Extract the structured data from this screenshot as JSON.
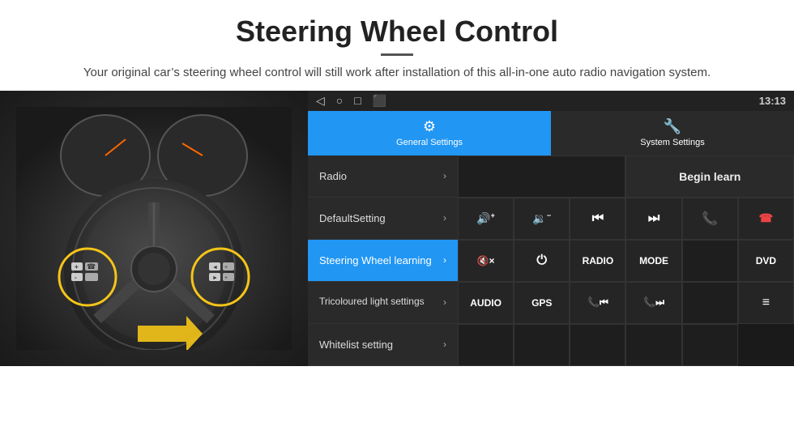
{
  "header": {
    "title": "Steering Wheel Control",
    "divider": true,
    "subtitle": "Your original car’s steering wheel control will still work after installation of this all-in-one auto radio navigation system."
  },
  "statusBar": {
    "icons": [
      "◁",
      "○",
      "□",
      "⬛"
    ],
    "right": "13:13",
    "signalIcons": [
      "wifi",
      "signal"
    ]
  },
  "tabs": [
    {
      "id": "general",
      "label": "General Settings",
      "icon": "⚙",
      "active": true
    },
    {
      "id": "system",
      "label": "System Settings",
      "icon": "🔧",
      "active": false
    }
  ],
  "menu": [
    {
      "id": "radio",
      "label": "Radio",
      "active": false
    },
    {
      "id": "default",
      "label": "DefaultSetting",
      "active": false
    },
    {
      "id": "steering",
      "label": "Steering Wheel learning",
      "active": true
    },
    {
      "id": "tricoloured",
      "label": "Tricoloured light settings",
      "active": false
    },
    {
      "id": "whitelist",
      "label": "Whitelist setting",
      "active": false
    }
  ],
  "buttons": {
    "begin_learn": "Begin learn",
    "grid": [
      {
        "id": "vol-up",
        "label": "🔊+",
        "col": 1
      },
      {
        "id": "vol-down",
        "label": "🔉−",
        "col": 1
      },
      {
        "id": "prev-track",
        "label": "⏮",
        "col": 1
      },
      {
        "id": "next-track",
        "label": "⏭",
        "col": 1
      },
      {
        "id": "phone",
        "label": "📞",
        "col": 1
      },
      {
        "id": "hang-up",
        "label": "📵",
        "col": 1
      },
      {
        "id": "mute",
        "label": "🔇×",
        "col": 1
      },
      {
        "id": "power",
        "label": "⏻",
        "col": 1
      },
      {
        "id": "radio-btn",
        "label": "RADIO",
        "col": 1
      },
      {
        "id": "mode",
        "label": "MODE",
        "col": 1
      },
      {
        "id": "dvd",
        "label": "DVD",
        "col": 1
      },
      {
        "id": "audio",
        "label": "AUDIO",
        "col": 1
      },
      {
        "id": "gps",
        "label": "GPS",
        "col": 1
      },
      {
        "id": "tel-prev",
        "label": "📞⏮",
        "col": 1
      },
      {
        "id": "tel-next",
        "label": "📞⏭",
        "col": 1
      },
      {
        "id": "list",
        "label": "≡",
        "col": 1
      }
    ]
  }
}
